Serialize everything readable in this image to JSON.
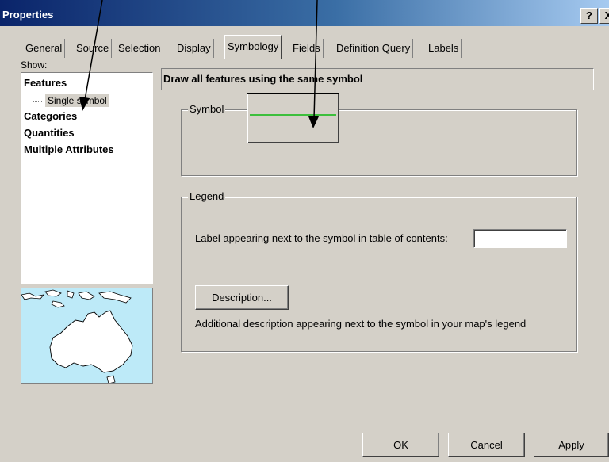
{
  "window": {
    "title": "Properties",
    "help_label": "?",
    "close_label": "X"
  },
  "tabs": [
    {
      "label": "General"
    },
    {
      "label": "Source"
    },
    {
      "label": "Selection"
    },
    {
      "label": "Display"
    },
    {
      "label": "Symbology"
    },
    {
      "label": "Fields"
    },
    {
      "label": "Definition Query"
    },
    {
      "label": "Labels"
    }
  ],
  "active_tab": "Symbology",
  "show": {
    "label": "Show:",
    "items": [
      {
        "label": "Features",
        "expanded": true
      },
      {
        "label": "Single symbol",
        "selected": true
      },
      {
        "label": "Categories"
      },
      {
        "label": "Quantities"
      },
      {
        "label": "Multiple Attributes"
      }
    ]
  },
  "preview": {
    "icon": "australia-map-icon"
  },
  "main": {
    "heading": "Draw all features using the same symbol",
    "symbol_group": {
      "title": "Symbol",
      "line_color": "#3cbf3c"
    },
    "legend_group": {
      "title": "Legend",
      "label_prompt": "Label appearing next to the symbol in table of contents:",
      "label_value": "",
      "description_button": "Description...",
      "description_text": "Additional description appearing next to the symbol in your map's legend"
    }
  },
  "footer": {
    "ok_label": "OK",
    "cancel_label": "Cancel",
    "apply_label": "Apply"
  },
  "colors": {
    "dialog_bg": "#d4d0c8",
    "titlebar_start": "#0a246a",
    "titlebar_end": "#a6caf0",
    "map_water": "#bdeaf8"
  }
}
